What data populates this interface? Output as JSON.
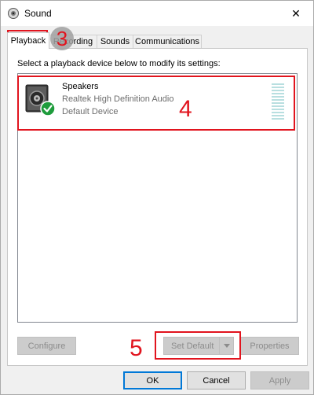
{
  "window": {
    "title": "Sound",
    "close_symbol": "✕"
  },
  "tabs": [
    {
      "label": "Playback",
      "active": true
    },
    {
      "label": "Recording",
      "active": false
    },
    {
      "label": "Sounds",
      "active": false
    },
    {
      "label": "Communications",
      "active": false
    }
  ],
  "playback": {
    "instruction": "Select a playback device below to modify its settings:",
    "devices": [
      {
        "name": "Speakers",
        "driver": "Realtek High Definition Audio",
        "status": "Default Device",
        "icon": "speaker-icon",
        "badge": "default-check-icon"
      }
    ]
  },
  "panel_buttons": {
    "configure": "Configure",
    "set_default": "Set Default",
    "properties": "Properties"
  },
  "dialog_buttons": {
    "ok": "OK",
    "cancel": "Cancel",
    "apply": "Apply"
  },
  "annotations": {
    "step3": "3",
    "step4": "4",
    "step5": "5"
  },
  "colors": {
    "annotation": "#e1141e",
    "focus": "#0078d7",
    "check_badge": "#1e9c3c"
  }
}
